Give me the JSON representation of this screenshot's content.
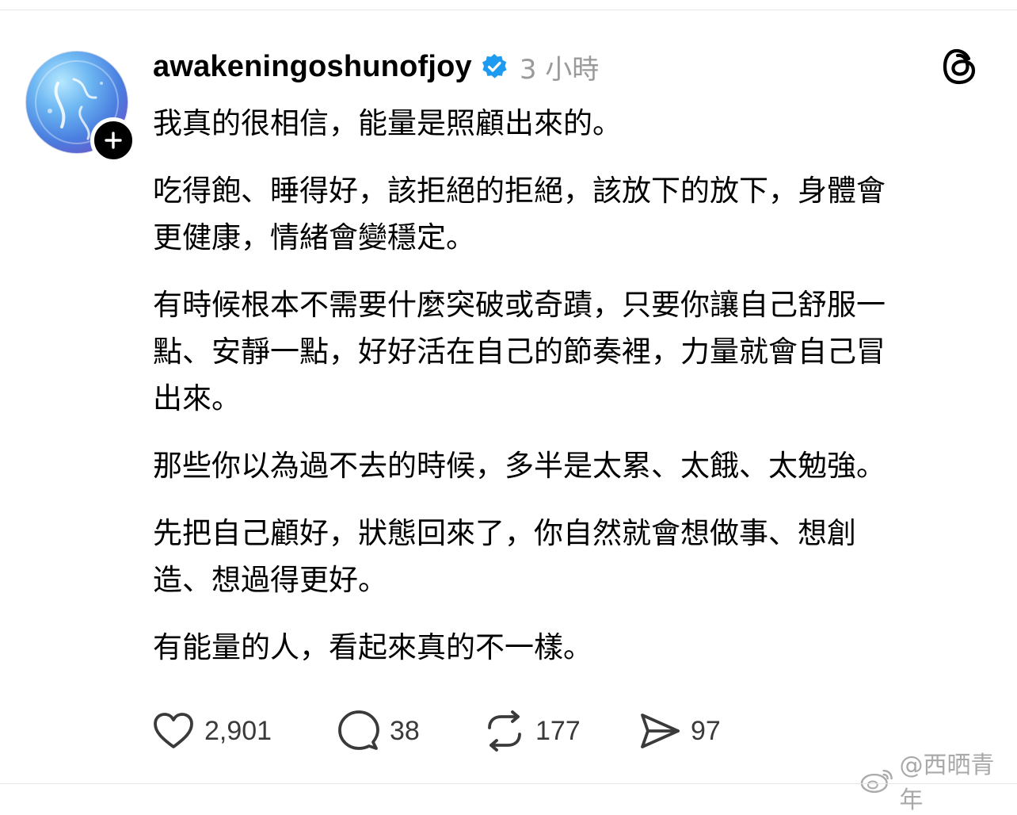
{
  "post": {
    "author": {
      "username": "awakeningoshunofjoy",
      "verified": true,
      "avatar_icon": "avatar-image",
      "follow_icon": "plus-icon"
    },
    "time_ago": "3 小時",
    "app_icon": "threads-logo-icon",
    "paragraphs": [
      "我真的很相信，能量是照顧出來的。",
      "吃得飽、睡得好，該拒絕的拒絕，該放下的放下，身體會\n更健康，情緒會變穩定。",
      "有時候根本不需要什麼突破或奇蹟，只要你讓自己舒服一\n點、安靜一點，好好活在自己的節奏裡，力量就會自己冒\n出來。",
      "那些你以為過不去的時候，多半是太累、太餓、太勉強。",
      "先把自己顧好，狀態回來了，你自然就會想做事、想創\n造、想過得更好。",
      "有能量的人，看起來真的不一樣。"
    ],
    "actions": {
      "likes": "2,901",
      "comments": "38",
      "reposts": "177",
      "shares": "97"
    }
  },
  "watermark": {
    "text": "@西晒青年",
    "icon": "weibo-icon"
  },
  "colors": {
    "verified_badge": "#1d9bf0",
    "secondary_text": "#9a9a9a"
  }
}
